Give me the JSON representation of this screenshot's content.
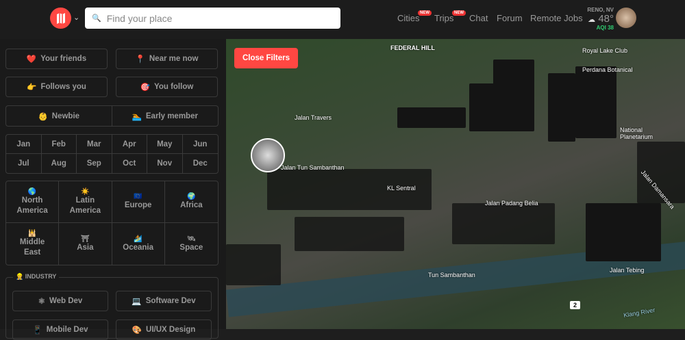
{
  "header": {
    "search_placeholder": "Find your place",
    "nav": [
      {
        "label": "Cities",
        "badge": "NEW"
      },
      {
        "label": "Trips",
        "badge": "NEW"
      },
      {
        "label": "Chat"
      },
      {
        "label": "Forum"
      },
      {
        "label": "Remote Jobs"
      }
    ],
    "weather": {
      "city": "RENO, NV",
      "temp": "48°",
      "aqi_label": "AQI",
      "aqi": "38",
      "icon": "☁"
    }
  },
  "filters": {
    "social": [
      {
        "icon": "❤️",
        "label": "Your friends"
      },
      {
        "icon": "📍",
        "label": "Near me now"
      },
      {
        "icon": "👉",
        "label": "Follows you"
      },
      {
        "icon": "🎯",
        "label": "You follow"
      },
      {
        "icon": "👶",
        "label": "Newbie"
      },
      {
        "icon": "🏊",
        "label": "Early member"
      }
    ],
    "months": [
      "Jan",
      "Feb",
      "Mar",
      "Apr",
      "May",
      "Jun",
      "Jul",
      "Aug",
      "Sep",
      "Oct",
      "Nov",
      "Dec"
    ],
    "regions": [
      {
        "icon": "🌎",
        "label": "North America"
      },
      {
        "icon": "☀️",
        "label": "Latin America"
      },
      {
        "icon": "🇪🇺",
        "label": "Europe"
      },
      {
        "icon": "🌍",
        "label": "Africa"
      },
      {
        "icon": "🕌",
        "label": "Middle East"
      },
      {
        "icon": "⛩",
        "label": "Asia"
      },
      {
        "icon": "🏄",
        "label": "Oceania"
      },
      {
        "icon": "🛰",
        "label": "Space"
      }
    ],
    "industry": {
      "title": "INDUSTRY",
      "icon": "👷",
      "items": [
        {
          "icon": "⚛",
          "label": "Web Dev"
        },
        {
          "icon": "💻",
          "label": "Software Dev"
        },
        {
          "icon": "📱",
          "label": "Mobile Dev"
        },
        {
          "icon": "🎨",
          "label": "UI/UX Design"
        }
      ]
    }
  },
  "map": {
    "close_filters": "Close Filters",
    "labels": [
      "FEDERAL HILL",
      "Jalan Travers",
      "Jalan Tun Sambanthan",
      "KL Sentral",
      "Jalan Padang Belia",
      "Jalan Damansara",
      "Jalan Tebing",
      "Klang River",
      "National Planetarium",
      "Royal Lake Club",
      "Perdana Botanical",
      "Tun Sambanthan"
    ],
    "road_shield": "2"
  }
}
